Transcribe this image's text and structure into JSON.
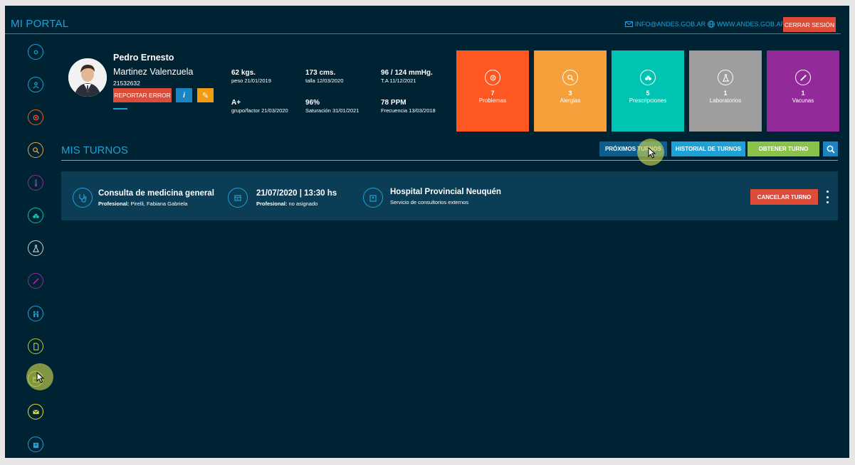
{
  "header": {
    "brand": "MI PORTAL",
    "email": "INFO@ANDES.GOB.AR",
    "website": "WWW.ANDES.GOB.AR",
    "logout_label": "CERRAR SESIÓN"
  },
  "patient": {
    "first_name": "Pedro Ernesto",
    "last_name": "Martinez Valenzuela",
    "dni": "21532632",
    "report_label": "REPORTAR ERROR",
    "info_label": "i",
    "edit_label": "✎"
  },
  "stats": [
    {
      "value": "62 kgs.",
      "label": "peso 21/01/2019"
    },
    {
      "value": "173 cms.",
      "label": "talla 12/03/2020"
    },
    {
      "value": "96 / 124 mmHg.",
      "label": "T.A 11/12/2021"
    },
    {
      "value": "A+",
      "label": "grupo/factor 21/03/2020"
    },
    {
      "value": "96%",
      "label": "Saturación 31/01/2021"
    },
    {
      "value": "78 PPM",
      "label": "Frecuencia 13/03/2018"
    }
  ],
  "cards": [
    {
      "count": "7",
      "label": "Problemas",
      "color": "#ff5722",
      "icon": "problems-icon"
    },
    {
      "count": "3",
      "label": "Alergias",
      "color": "#f5a03a",
      "icon": "allergies-icon"
    },
    {
      "count": "5",
      "label": "Prescripciones",
      "color": "#00c4b2",
      "icon": "prescriptions-icon"
    },
    {
      "count": "1",
      "label": "Laboratorios",
      "color": "#9e9e9e",
      "icon": "laboratory-icon"
    },
    {
      "count": "1",
      "label": "Vacunas",
      "color": "#922a9a",
      "icon": "vaccine-icon"
    }
  ],
  "turnos": {
    "title": "MIS TURNOS",
    "btn_proximos": "PRÓXIMOS TURNOS",
    "btn_historial": "HISTORIAL DE TURNOS",
    "btn_obtener": "OBTENER TURNO",
    "appointment": {
      "service": "Consulta de medicina general",
      "professional_label": "Profesional:",
      "professional": "Pirelli, Fabiana Gabriela",
      "datetime": "21/07/2020 | 13:30 hs",
      "professional2_label": "Profesional:",
      "professional2": "no asignado",
      "place": "Hospital Provincial Neuquén",
      "place_sub": "Servicio de consultorios externos",
      "cancel_label": "CANCELAR TURNO"
    }
  },
  "sidebar_icons": [
    {
      "name": "dashboard-icon",
      "color": "#1ea1d6"
    },
    {
      "name": "profile-icon",
      "color": "#1ea1d6"
    },
    {
      "name": "problems-icon",
      "color": "#ff5722"
    },
    {
      "name": "allergies-icon",
      "color": "#f5a03a"
    },
    {
      "name": "vitals-icon",
      "color": "#922a9a"
    },
    {
      "name": "prescriptions-icon",
      "color": "#00c4b2"
    },
    {
      "name": "laboratory-icon",
      "color": "#c0c0c0"
    },
    {
      "name": "vaccine-icon",
      "color": "#922a9a"
    },
    {
      "name": "family-icon",
      "color": "#1ea1d6"
    },
    {
      "name": "documents-icon",
      "color": "#b5cc3a"
    },
    {
      "name": "appointments-icon",
      "color": "#b5cc3a"
    },
    {
      "name": "messages-icon",
      "color": "#e8e020"
    },
    {
      "name": "hospital-icon",
      "color": "#1ea1d6"
    }
  ]
}
